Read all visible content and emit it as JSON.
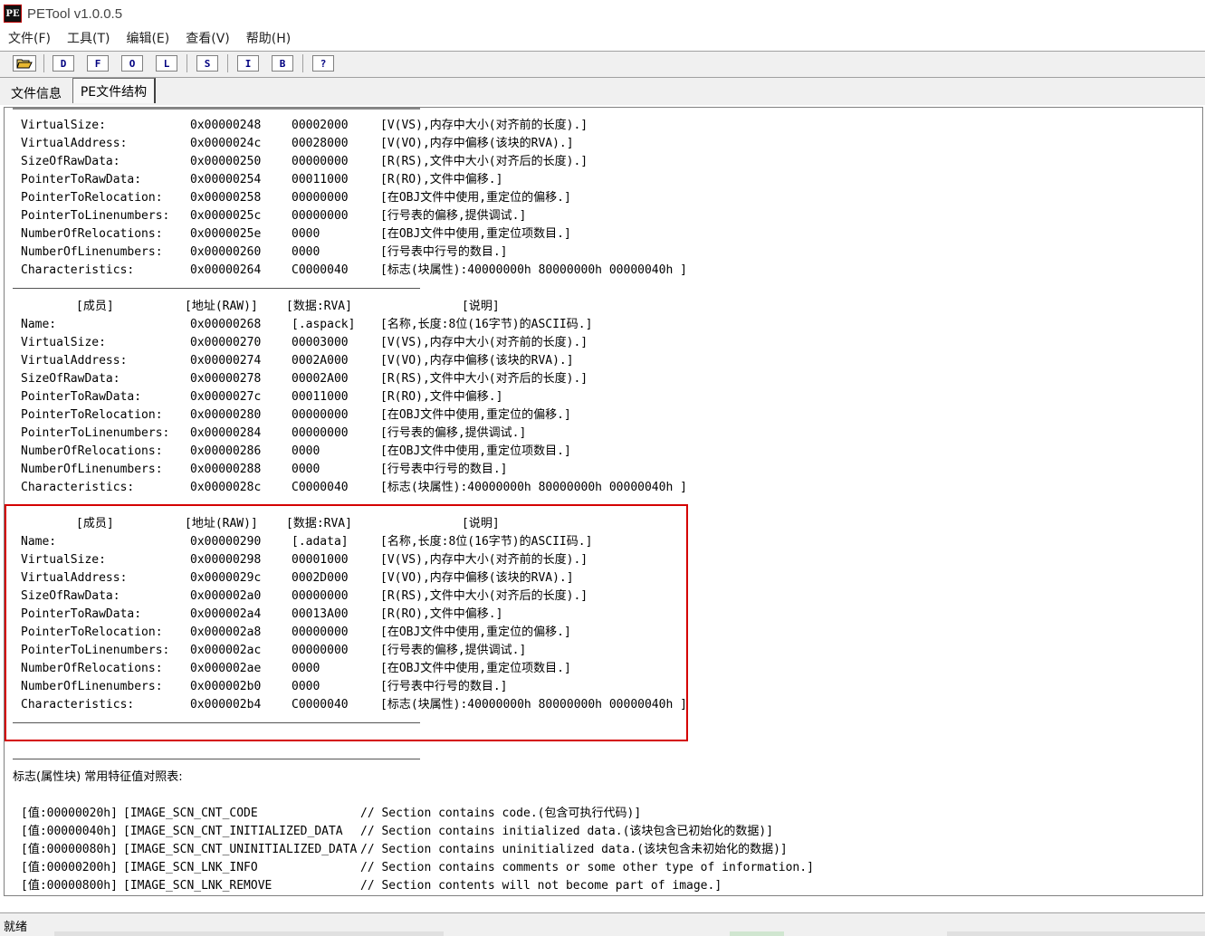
{
  "window": {
    "title": "PETool v1.0.0.5",
    "icon_text": "PE"
  },
  "menu": [
    "文件(F)",
    "工具(T)",
    "编辑(E)",
    "查看(V)",
    "帮助(H)"
  ],
  "toolbar": {
    "open_icon": "folder-open-icon",
    "buttons": [
      "D",
      "F",
      "O",
      "L",
      "S",
      "I",
      "B",
      "?"
    ]
  },
  "tabs": [
    "文件信息",
    "PE文件结构"
  ],
  "sections": [
    {
      "rows": [
        {
          "name": "VirtualSize:",
          "addr": "0x00000248",
          "data": "00002000",
          "desc": "[V(VS),内存中大小(对齐前的长度).]"
        },
        {
          "name": "VirtualAddress:",
          "addr": "0x0000024c",
          "data": "00028000",
          "desc": "[V(VO),内存中偏移(该块的RVA).]"
        },
        {
          "name": "SizeOfRawData:",
          "addr": "0x00000250",
          "data": "00000000",
          "desc": "[R(RS),文件中大小(对齐后的长度).]"
        },
        {
          "name": "PointerToRawData:",
          "addr": "0x00000254",
          "data": "00011000",
          "desc": "[R(RO),文件中偏移.]"
        },
        {
          "name": "PointerToRelocation:",
          "addr": "0x00000258",
          "data": "00000000",
          "desc": "[在OBJ文件中使用,重定位的偏移.]"
        },
        {
          "name": "PointerToLinenumbers:",
          "addr": "0x0000025c",
          "data": "00000000",
          "desc": "[行号表的偏移,提供调试.]"
        },
        {
          "name": "NumberOfRelocations:",
          "addr": "0x0000025e",
          "data": "0000",
          "desc": "[在OBJ文件中使用,重定位项数目.]"
        },
        {
          "name": "NumberOfLinenumbers:",
          "addr": "0x00000260",
          "data": "0000",
          "desc": "[行号表中行号的数目.]"
        },
        {
          "name": "Characteristics:",
          "addr": "0x00000264",
          "data": "C0000040",
          "desc": "[标志(块属性):40000000h 80000000h 00000040h ]"
        }
      ]
    },
    {
      "header": {
        "name": "[成员]",
        "addr": "[地址(RAW)]",
        "data": "[数据:RVA]",
        "desc": "[说明]"
      },
      "rows": [
        {
          "name": "Name:",
          "addr": "0x00000268",
          "data": "[.aspack]",
          "desc": "[名称,长度:8位(16字节)的ASCII码.]"
        },
        {
          "name": "VirtualSize:",
          "addr": "0x00000270",
          "data": "00003000",
          "desc": "[V(VS),内存中大小(对齐前的长度).]"
        },
        {
          "name": "VirtualAddress:",
          "addr": "0x00000274",
          "data": "0002A000",
          "desc": "[V(VO),内存中偏移(该块的RVA).]"
        },
        {
          "name": "SizeOfRawData:",
          "addr": "0x00000278",
          "data": "00002A00",
          "desc": "[R(RS),文件中大小(对齐后的长度).]"
        },
        {
          "name": "PointerToRawData:",
          "addr": "0x0000027c",
          "data": "00011000",
          "desc": "[R(RO),文件中偏移.]"
        },
        {
          "name": "PointerToRelocation:",
          "addr": "0x00000280",
          "data": "00000000",
          "desc": "[在OBJ文件中使用,重定位的偏移.]"
        },
        {
          "name": "PointerToLinenumbers:",
          "addr": "0x00000284",
          "data": "00000000",
          "desc": "[行号表的偏移,提供调试.]"
        },
        {
          "name": "NumberOfRelocations:",
          "addr": "0x00000286",
          "data": "0000",
          "desc": "[在OBJ文件中使用,重定位项数目.]"
        },
        {
          "name": "NumberOfLinenumbers:",
          "addr": "0x00000288",
          "data": "0000",
          "desc": "[行号表中行号的数目.]"
        },
        {
          "name": "Characteristics:",
          "addr": "0x0000028c",
          "data": "C0000040",
          "desc": "[标志(块属性):40000000h 80000000h 00000040h ]"
        }
      ]
    },
    {
      "header": {
        "name": "[成员]",
        "addr": "[地址(RAW)]",
        "data": "[数据:RVA]",
        "desc": "[说明]"
      },
      "rows": [
        {
          "name": "Name:",
          "addr": "0x00000290",
          "data": "[.adata]",
          "desc": "[名称,长度:8位(16字节)的ASCII码.]"
        },
        {
          "name": "VirtualSize:",
          "addr": "0x00000298",
          "data": "00001000",
          "desc": "[V(VS),内存中大小(对齐前的长度).]"
        },
        {
          "name": "VirtualAddress:",
          "addr": "0x0000029c",
          "data": "0002D000",
          "desc": "[V(VO),内存中偏移(该块的RVA).]"
        },
        {
          "name": "SizeOfRawData:",
          "addr": "0x000002a0",
          "data": "00000000",
          "desc": "[R(RS),文件中大小(对齐后的长度).]"
        },
        {
          "name": "PointerToRawData:",
          "addr": "0x000002a4",
          "data": "00013A00",
          "desc": "[R(RO),文件中偏移.]"
        },
        {
          "name": "PointerToRelocation:",
          "addr": "0x000002a8",
          "data": "00000000",
          "desc": "[在OBJ文件中使用,重定位的偏移.]"
        },
        {
          "name": "PointerToLinenumbers:",
          "addr": "0x000002ac",
          "data": "00000000",
          "desc": "[行号表的偏移,提供调试.]"
        },
        {
          "name": "NumberOfRelocations:",
          "addr": "0x000002ae",
          "data": "0000",
          "desc": "[在OBJ文件中使用,重定位项数目.]"
        },
        {
          "name": "NumberOfLinenumbers:",
          "addr": "0x000002b0",
          "data": "0000",
          "desc": "[行号表中行号的数目.]"
        },
        {
          "name": "Characteristics:",
          "addr": "0x000002b4",
          "data": "C0000040",
          "desc": "[标志(块属性):40000000h 80000000h 00000040h ]"
        }
      ]
    }
  ],
  "flags_title": "标志(属性块) 常用特征值对照表:",
  "flags": [
    {
      "val": "[值:00000020h]",
      "name": "[IMAGE_SCN_CNT_CODE",
      "comment": "// Section contains code.(包含可执行代码)]"
    },
    {
      "val": "[值:00000040h]",
      "name": "[IMAGE_SCN_CNT_INITIALIZED_DATA",
      "comment": "// Section contains initialized data.(该块包含已初始化的数据)]"
    },
    {
      "val": "[值:00000080h]",
      "name": "[IMAGE_SCN_CNT_UNINITIALIZED_DATA",
      "comment": "// Section contains uninitialized data.(该块包含未初始化的数据)]"
    },
    {
      "val": "[值:00000200h]",
      "name": "[IMAGE_SCN_LNK_INFO",
      "comment": "// Section contains comments or some other type of information.]"
    },
    {
      "val": "[值:00000800h]",
      "name": "[IMAGE_SCN_LNK_REMOVE",
      "comment": "// Section contents will not become part of image.]"
    }
  ],
  "status": "就绪",
  "colors": {
    "highlight_border": "#d40000",
    "toolbar_text": "#000080"
  }
}
